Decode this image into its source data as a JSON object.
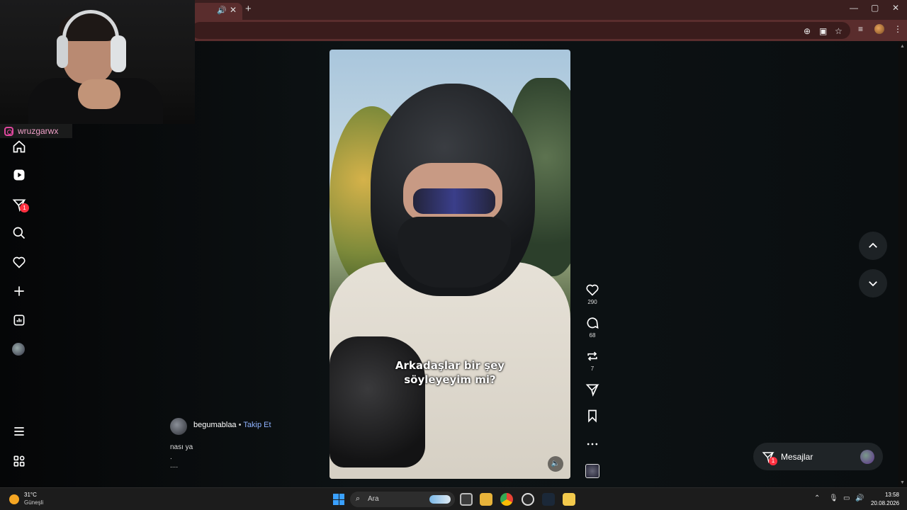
{
  "webcam": {
    "handle": "wruzgarwx"
  },
  "nav": {
    "notifications_badge": "1"
  },
  "reel": {
    "caption_line1": "Arkadaşlar bir şey",
    "caption_line2": "söyleyeyim mi?",
    "likes": "290",
    "comments": "68",
    "reposts": "7",
    "author": "begumablaa",
    "separator": "•",
    "follow_label": "Takip Et",
    "description_lines": [
      "nası ya",
      ".",
      "...."
    ]
  },
  "messages": {
    "label": "Mesajlar",
    "badge": "1"
  },
  "taskbar": {
    "temperature": "31°C",
    "condition": "Güneşli",
    "search_placeholder": "Ara",
    "time": "13:58",
    "date": "20.08.2026"
  },
  "colors": {
    "accent_follow": "#8fb3ff",
    "badge": "#ff3040",
    "browser_frame": "#5a2d2d"
  }
}
